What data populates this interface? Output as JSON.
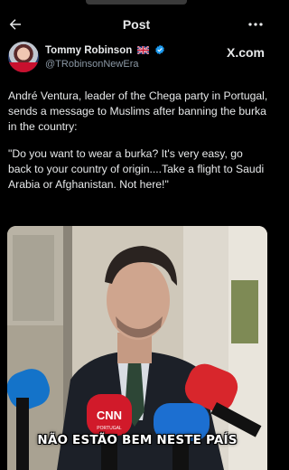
{
  "header": {
    "title": "Post"
  },
  "author": {
    "display_name": "Tommy Robinson",
    "handle": "@TRobinsonNewEra",
    "platform_logo": "X.com",
    "flag_icon": "uk-flag-icon",
    "verified_icon": "verified-badge-icon"
  },
  "tweet": {
    "paragraph1": "André Ventura, leader of the Chega party in Portugal, sends a message to Muslims after banning the burka in the country:",
    "paragraph2": "\"Do you want to wear a burka? It's very easy, go back to your country of origin....Take a flight to Saudi Arabia or Afghanistan. Not here!\""
  },
  "media": {
    "subtitle": "NÃO ESTÃO BEM NESTE PAÍS",
    "mic_cnn_label": "CNN",
    "mic_cnn_sub": "PORTUGAL"
  },
  "colors": {
    "background": "#000000",
    "text": "#e7e9ea",
    "secondary_text": "#8b98a5",
    "verified": "#1d9bf0"
  }
}
